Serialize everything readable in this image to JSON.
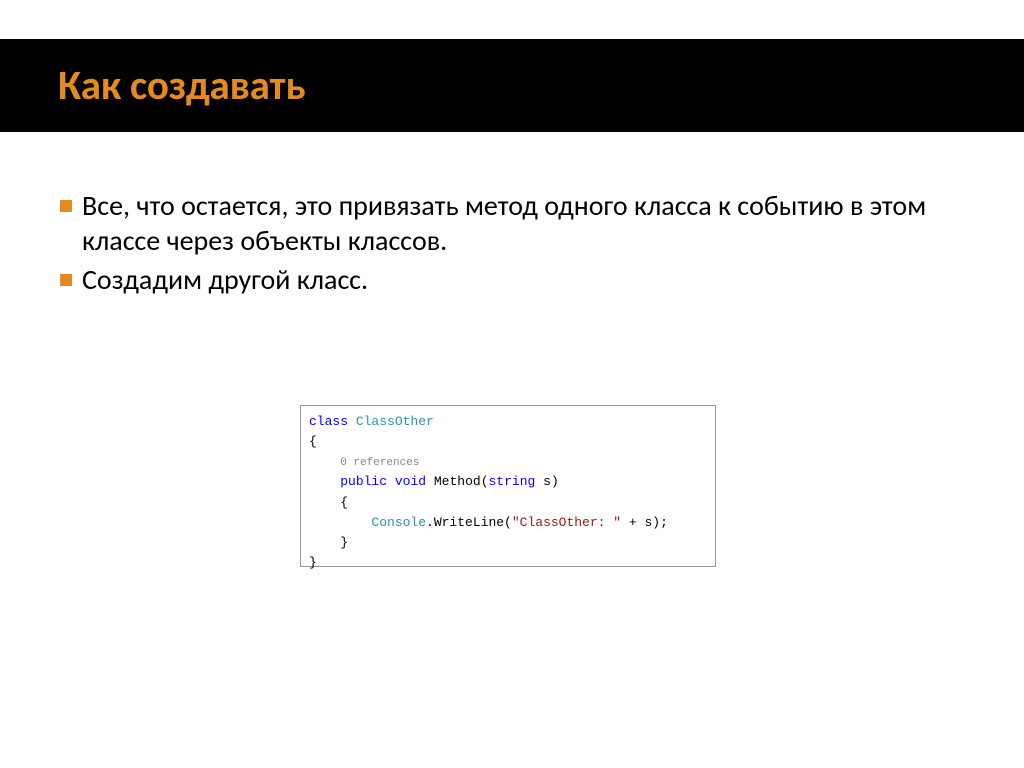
{
  "header": {
    "title": "Как создавать"
  },
  "bullets": [
    "Все, что остается, это привязать метод одного класса к событию в этом классе через объекты классов.",
    "Создадим другой класс."
  ],
  "code": {
    "l1": {
      "kw": "class",
      "cls": "ClassOther"
    },
    "l2": "{",
    "l3": "0 references",
    "l4": {
      "kw1": "public",
      "kw2": "void",
      "name": "Method",
      "kw3": "string",
      "param": "s"
    },
    "l5": "    {",
    "l6": {
      "cls": "Console",
      "call": ".WriteLine(",
      "str": "\"ClassOther: \"",
      "tail": " + s);"
    },
    "l7": "    }",
    "l8": "}"
  }
}
